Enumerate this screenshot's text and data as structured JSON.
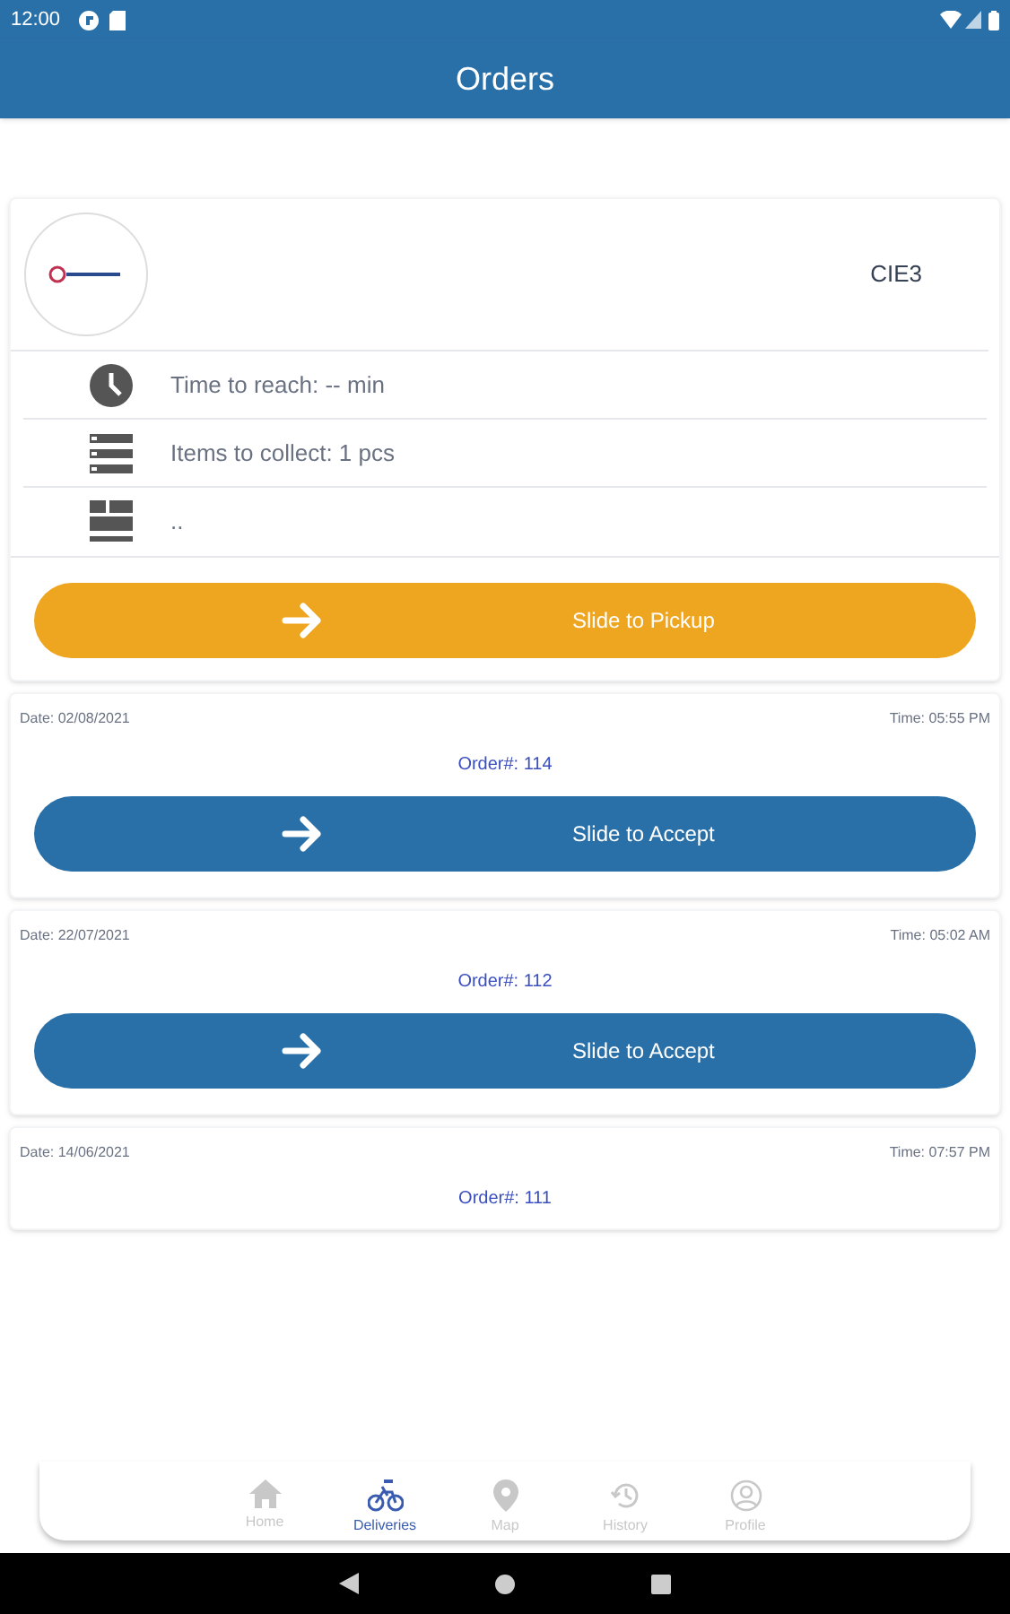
{
  "status_bar": {
    "time": "12:00"
  },
  "app_bar": {
    "title": "Orders"
  },
  "pickup": {
    "code": "CIE3",
    "rows": [
      {
        "kind": "clock",
        "text": "Time to reach: -- min"
      },
      {
        "kind": "list",
        "text": "Items to collect: 1 pcs"
      },
      {
        "kind": "grid",
        "text": ".."
      }
    ],
    "button": "Slide to Pickup"
  },
  "orders": [
    {
      "date": "Date: 02/08/2021",
      "time": "Time: 05:55 PM",
      "order": "Order#: 114",
      "button": "Slide to Accept"
    },
    {
      "date": "Date: 22/07/2021",
      "time": "Time: 05:02 AM",
      "order": "Order#: 112",
      "button": "Slide to Accept"
    },
    {
      "date": "Date: 14/06/2021",
      "time": "Time: 07:57 PM",
      "order": "Order#: 111"
    }
  ],
  "bottom_nav": [
    {
      "kind": "home",
      "label": "Home",
      "selected": false
    },
    {
      "kind": "bike",
      "label": "Deliveries",
      "selected": true
    },
    {
      "kind": "pin",
      "label": "Map",
      "selected": false
    },
    {
      "kind": "history",
      "label": "History",
      "selected": false
    },
    {
      "kind": "profile",
      "label": "Profile",
      "selected": false
    }
  ]
}
